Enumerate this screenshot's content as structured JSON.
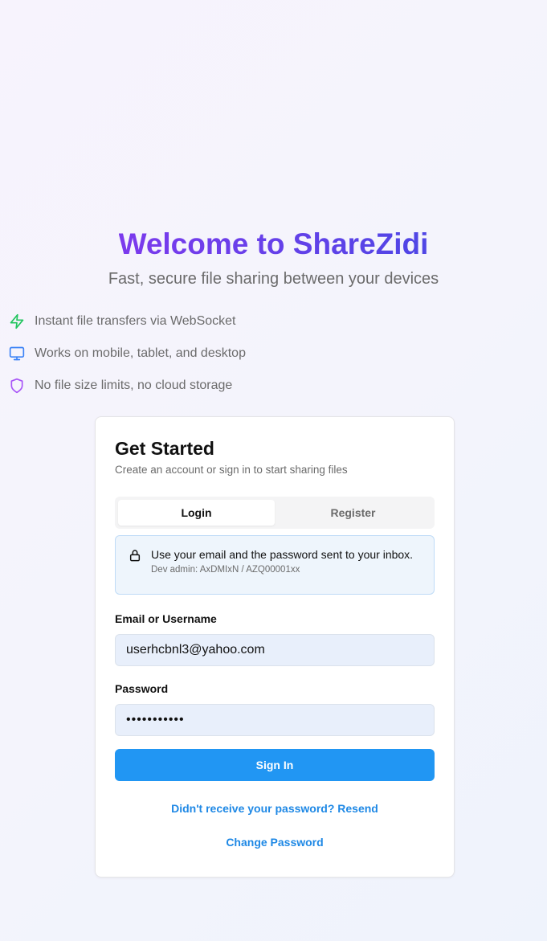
{
  "hero": {
    "title": "Welcome to ShareZidi",
    "subtitle": "Fast, secure file sharing between your devices"
  },
  "features": [
    {
      "icon": "lightning-icon",
      "color": "#22c55e",
      "text": "Instant file transfers via WebSocket"
    },
    {
      "icon": "monitor-icon",
      "color": "#3b82f6",
      "text": "Works on mobile, tablet, and desktop"
    },
    {
      "icon": "shield-icon",
      "color": "#a855f7",
      "text": "No file size limits, no cloud storage"
    }
  ],
  "card": {
    "title": "Get Started",
    "description": "Create an account or sign in to start sharing files",
    "tabs": [
      {
        "label": "Login",
        "active": true
      },
      {
        "label": "Register",
        "active": false
      }
    ],
    "notice": {
      "icon": "lock-icon",
      "message": "Use your email and the password sent to your inbox.",
      "dev_hint": "Dev admin: AxDMIxN / AZQ00001xx"
    },
    "form": {
      "email_label": "Email or Username",
      "email_value": "userhcbnl3@yahoo.com",
      "password_label": "Password",
      "password_value": "•••••••••••",
      "submit_label": "Sign In"
    },
    "links": {
      "resend": "Didn't receive your password? Resend",
      "change_password": "Change Password"
    }
  },
  "colors": {
    "brand_gradient_start": "#7c3aed",
    "brand_gradient_end": "#4f46e5",
    "primary_button": "#2196f3",
    "link": "#1e88e5"
  }
}
